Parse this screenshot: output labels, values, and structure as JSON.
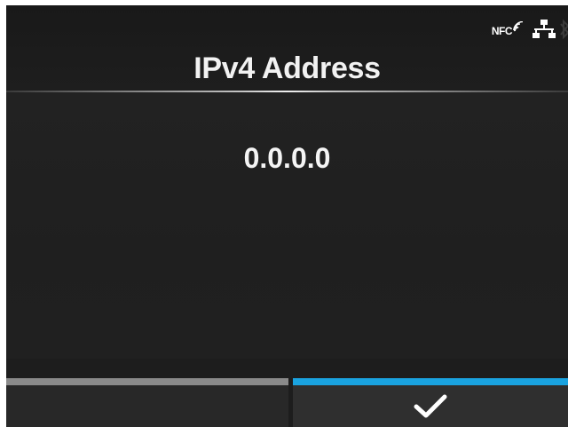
{
  "header": {
    "title": "IPv4 Address",
    "status": {
      "nfc_label": "NFC",
      "icons": [
        "nfc-signal-icon",
        "lan-icon",
        "bluetooth-icon"
      ]
    }
  },
  "main": {
    "ip_value": "0.0.0.0"
  },
  "footer": {
    "left_button": {
      "label": "",
      "accent": "#8a8a8a"
    },
    "right_button": {
      "icon": "checkmark-icon",
      "accent": "#1aa3e0"
    }
  },
  "colors": {
    "background": "#1d1d1d",
    "text": "#f2f2f2",
    "confirm_accent": "#1aa3e0"
  }
}
